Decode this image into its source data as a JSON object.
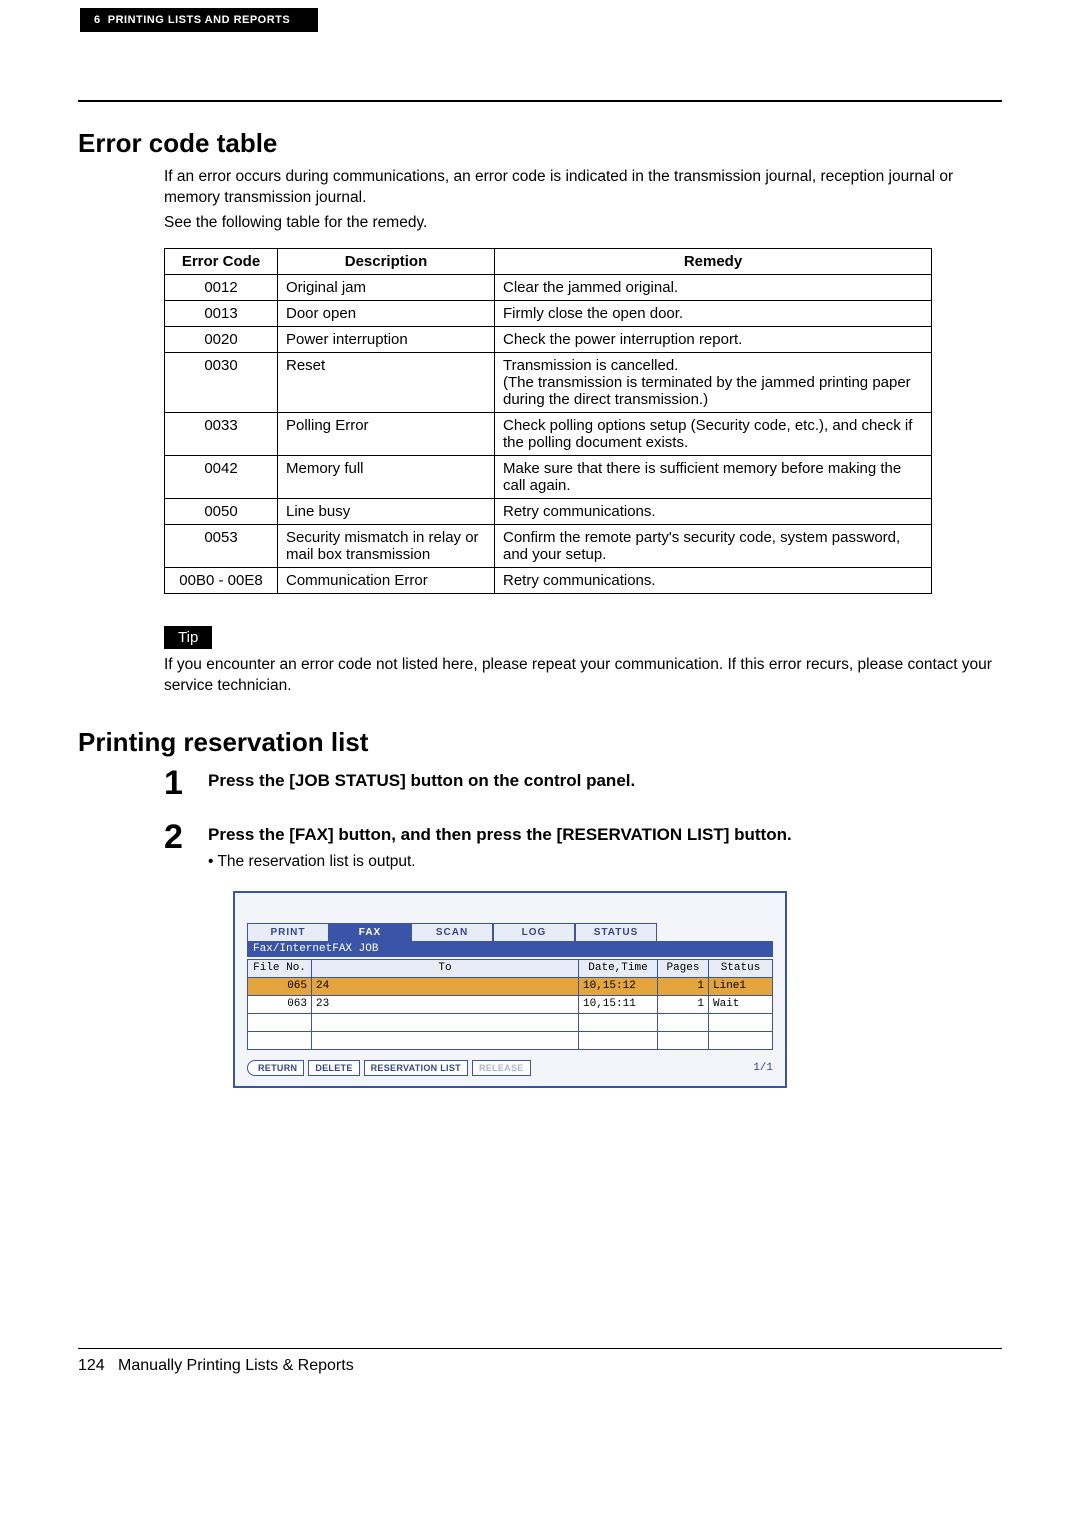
{
  "header": {
    "section_number": "6",
    "section_title": "PRINTING LISTS AND REPORTS"
  },
  "section1": {
    "title": "Error code table",
    "intro_line1": "If an error occurs during communications, an error code is indicated in the transmission journal, reception journal or memory transmission journal.",
    "intro_line2": "See the following table for the remedy.",
    "columns": {
      "c1": "Error Code",
      "c2": "Description",
      "c3": "Remedy"
    },
    "rows": [
      {
        "code": "0012",
        "desc": "Original jam",
        "remedy": "Clear the jammed original."
      },
      {
        "code": "0013",
        "desc": "Door open",
        "remedy": "Firmly close the open door."
      },
      {
        "code": "0020",
        "desc": "Power interruption",
        "remedy": "Check the power interruption report."
      },
      {
        "code": "0030",
        "desc": "Reset",
        "remedy": "Transmission is cancelled.\n(The transmission is terminated by the jammed printing paper during the direct transmission.)"
      },
      {
        "code": "0033",
        "desc": "Polling Error",
        "remedy": "Check polling options setup (Security code, etc.), and check if the polling document exists."
      },
      {
        "code": "0042",
        "desc": "Memory full",
        "remedy": "Make sure that there is sufficient memory before making the call again."
      },
      {
        "code": "0050",
        "desc": "Line busy",
        "remedy": "Retry communications."
      },
      {
        "code": "0053",
        "desc": "Security mismatch in relay or mail box transmission",
        "remedy": "Confirm the remote party's security code, system password, and your setup."
      },
      {
        "code": "00B0 - 00E8",
        "desc": "Communication Error",
        "remedy": "Retry communications."
      }
    ],
    "tip_label": "Tip",
    "tip_text": "If you encounter an error code not listed here, please repeat your communication. If this error recurs, please contact your service technician."
  },
  "section2": {
    "title": "Printing reservation list",
    "steps": [
      {
        "num": "1",
        "title": "Press the [JOB STATUS] button on the control panel."
      },
      {
        "num": "2",
        "title": "Press the [FAX] button, and then press the [RESERVATION LIST] button.",
        "bullet": "The reservation list is output."
      }
    ]
  },
  "screen": {
    "tabs": {
      "print": "PRINT",
      "fax": "FAX",
      "scan": "SCAN",
      "log": "LOG",
      "status": "STATUS"
    },
    "subbar": "Fax/InternetFAX JOB",
    "headers": {
      "file": "File No.",
      "to": "To",
      "date": "Date,Time",
      "pages": "Pages",
      "status": "Status"
    },
    "rows": [
      {
        "file": "065",
        "to": "24",
        "date": "10,15:12",
        "pages": "1",
        "status": "Line1",
        "selected": true
      },
      {
        "file": "063",
        "to": "23",
        "date": "10,15:11",
        "pages": "1",
        "status": "Wait",
        "selected": false
      }
    ],
    "buttons": {
      "return": "RETURN",
      "delete": "DELETE",
      "reservation": "RESERVATION LIST",
      "release": "RELEASE"
    },
    "pager": "1/1"
  },
  "footer": {
    "page_number": "124",
    "page_title": "Manually Printing Lists & Reports"
  }
}
